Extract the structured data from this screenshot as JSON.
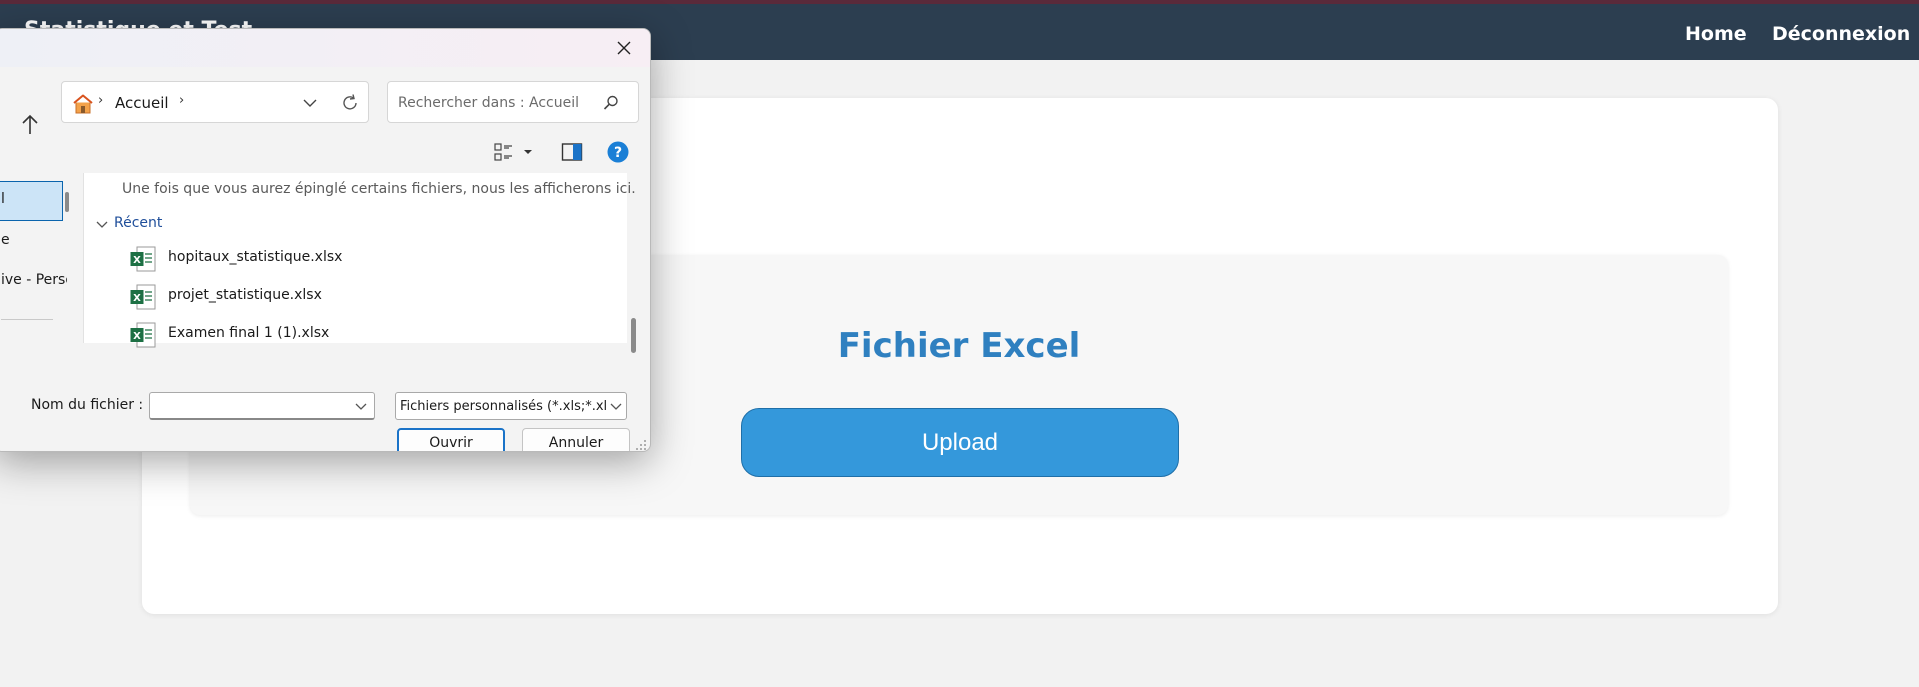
{
  "navbar": {
    "brand": "Statistique et Test",
    "links": [
      "Home",
      "Déconnexion"
    ]
  },
  "main": {
    "title": "Fichier Excel",
    "upload_label": "Upload"
  },
  "dialog": {
    "address_path": "Accueil",
    "search_placeholder": "Rechercher dans : Accueil",
    "nav_items": [
      "l",
      "e",
      "ive - Perso"
    ],
    "pinned_message": "Une fois que vous aurez épinglé certains fichiers, nous les afficherons ici.",
    "recent_label": "Récent",
    "files": [
      "hopitaux_statistique.xlsx",
      "projet_statistique.xlsx",
      "Examen final 1 (1).xlsx"
    ],
    "filename_label": "Nom du fichier :",
    "filename_value": "",
    "filter_selected": "Fichiers personnalisés (*.xls;*.xls",
    "open_label": "Ouvrir",
    "cancel_label": "Annuler"
  },
  "colors": {
    "navbar_bg": "#2c3e50",
    "accent_title": "#2f80c0",
    "upload_bg": "#3498db",
    "excel_green": "#1d7044"
  },
  "icons": [
    "home-icon",
    "chevron-right-icon",
    "chevron-down-icon",
    "refresh-icon",
    "search-icon",
    "up-arrow-icon",
    "view-options-icon",
    "preview-pane-icon",
    "help-icon",
    "close-icon",
    "excel-file-icon"
  ]
}
